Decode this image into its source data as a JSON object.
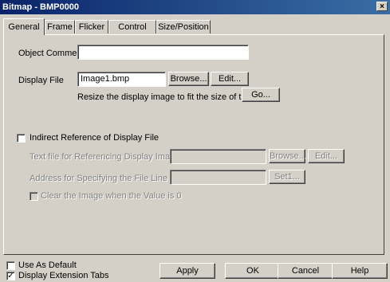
{
  "window": {
    "title": "Bitmap - BMP0000",
    "close_glyph": "×"
  },
  "tabs": [
    "General",
    "Frame",
    "Flicker",
    "Control Flag",
    "Size/Position"
  ],
  "general": {
    "object_comment_label": "Object Comment",
    "object_comment_value": "",
    "display_file_label": "Display File",
    "display_file_value": "Image1.bmp",
    "browse_label": "Browse...",
    "edit_label": "Edit...",
    "resize_text": "Resize the display image to fit the size of the object.",
    "go_label": "Go..."
  },
  "indirect": {
    "checkbox_label": "Indirect Reference of Display File",
    "checked": false,
    "text_file_label": "Text file for Referencing Display Image",
    "text_file_value": "",
    "browse_label": "Browse...",
    "edit_label": "Edit...",
    "address_label": "Address for Specifying the File Line",
    "address_value": "",
    "set_label": "Set1...",
    "clear_label": "Clear the Image when the Value is 0"
  },
  "footer": {
    "use_as_default_label": "Use As Default",
    "use_as_default_checked": false,
    "display_extension_tabs_label": "Display Extension Tabs",
    "display_extension_tabs_checked": true,
    "apply_label": "Apply",
    "ok_label": "OK",
    "cancel_label": "Cancel",
    "help_label": "Help"
  }
}
